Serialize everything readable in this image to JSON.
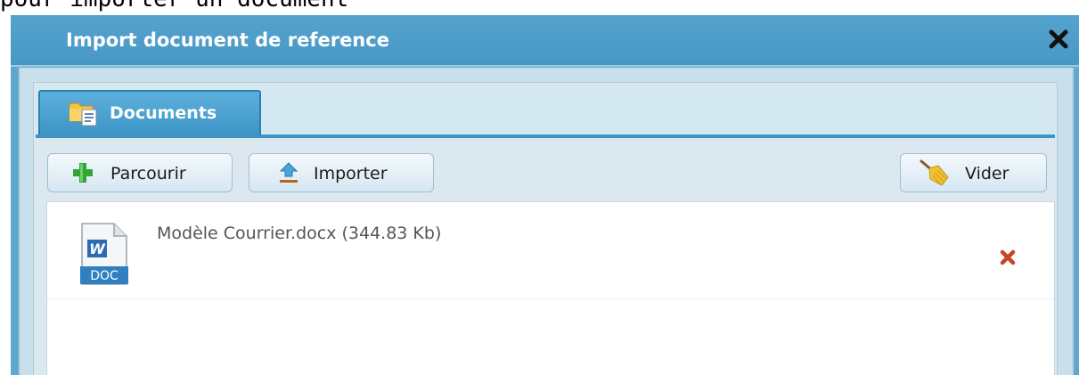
{
  "background_text": "pour importer un document",
  "dialog": {
    "title": "Import document de reference",
    "close_icon": "close-icon"
  },
  "tabs": [
    {
      "label": "Documents",
      "icon": "documents-folder-icon",
      "active": true
    }
  ],
  "toolbar": {
    "browse_label": "Parcourir",
    "browse_icon": "plus-icon",
    "import_label": "Importer",
    "import_icon": "upload-icon",
    "clear_label": "Vider",
    "clear_icon": "broom-icon"
  },
  "files": [
    {
      "name": "Modèle Courrier.docx (344.83 Kb)",
      "icon": "word-doc-icon",
      "icon_badge": "DOC",
      "icon_letter": "W",
      "remove_icon": "remove-icon"
    }
  ],
  "colors": {
    "titlebar": "#4fa0cb",
    "tab_active": "#3c95c6",
    "remove_red": "#c9432a",
    "plus_green": "#33a533"
  }
}
